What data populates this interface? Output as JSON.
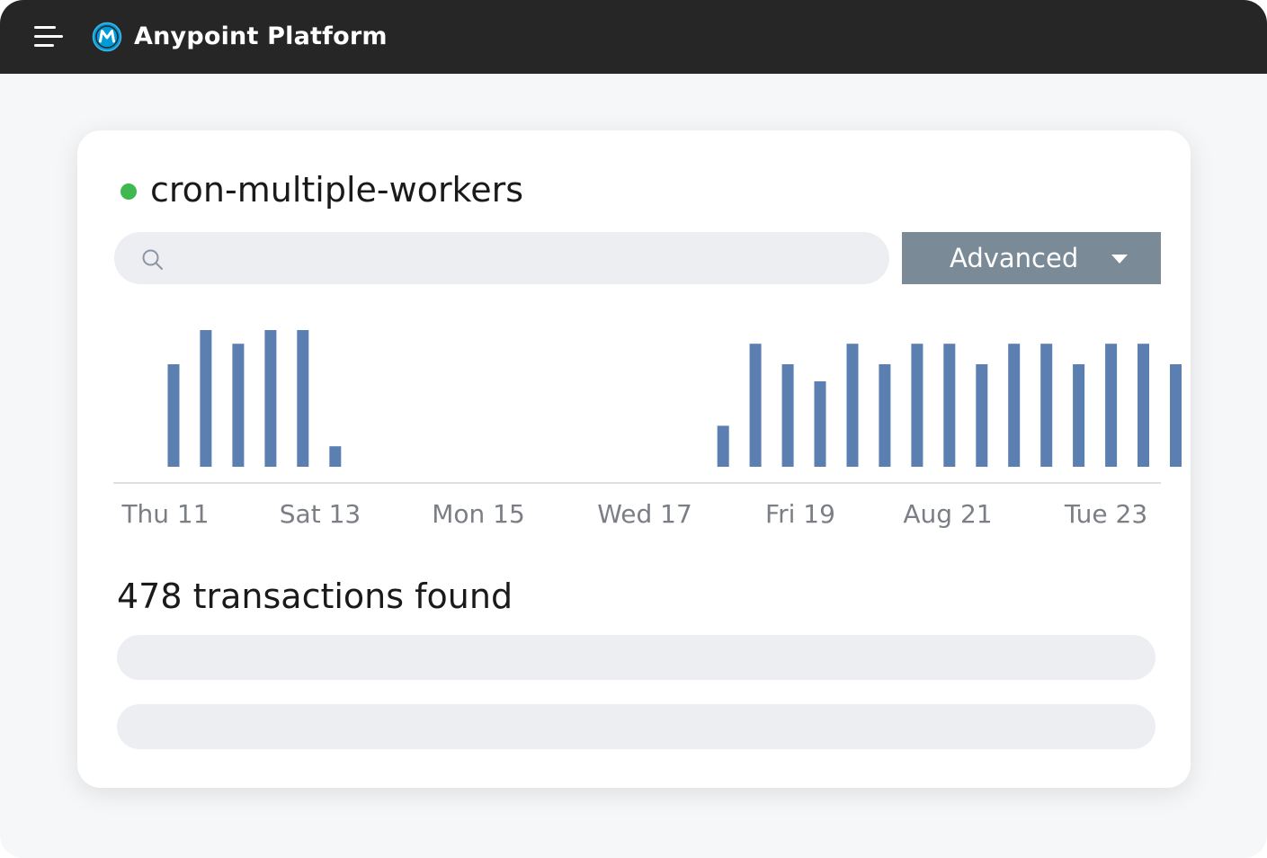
{
  "header": {
    "app_title": "Anypoint Platform",
    "menu_icon": "hamburger-menu-icon",
    "logo_icon": "mulesoft-logo-icon",
    "background": "#262626"
  },
  "card": {
    "app_name": "cron-multiple-workers",
    "status_color": "#3fb850",
    "search": {
      "placeholder": "",
      "value": "",
      "icon": "search-icon"
    },
    "filter_button": {
      "label": "Advanced",
      "icon": "chevron-down-icon",
      "background": "#7a8a97"
    },
    "result_count_text": "478 transactions found",
    "placeholder_rows": 2
  },
  "chart_data": {
    "type": "bar",
    "bar_color": "#5a7fb0",
    "tick_labels": [
      "Thu 11",
      "Sat 13",
      "Mon 15",
      "Wed 17",
      "Fri 19",
      "Aug 21",
      "Tue 23"
    ],
    "values": [
      3,
      4,
      3.6,
      4,
      4,
      0.6,
      0,
      0,
      0,
      0,
      0,
      0,
      0,
      0,
      0,
      0,
      0,
      1.2,
      3.6,
      3,
      2.5,
      3.6,
      3,
      3.6,
      3.6,
      3,
      3.6,
      3.6,
      3,
      3.6,
      3.6,
      3
    ],
    "ylim": [
      0,
      4
    ],
    "grid": false,
    "title": "",
    "xlabel": "",
    "ylabel": ""
  }
}
